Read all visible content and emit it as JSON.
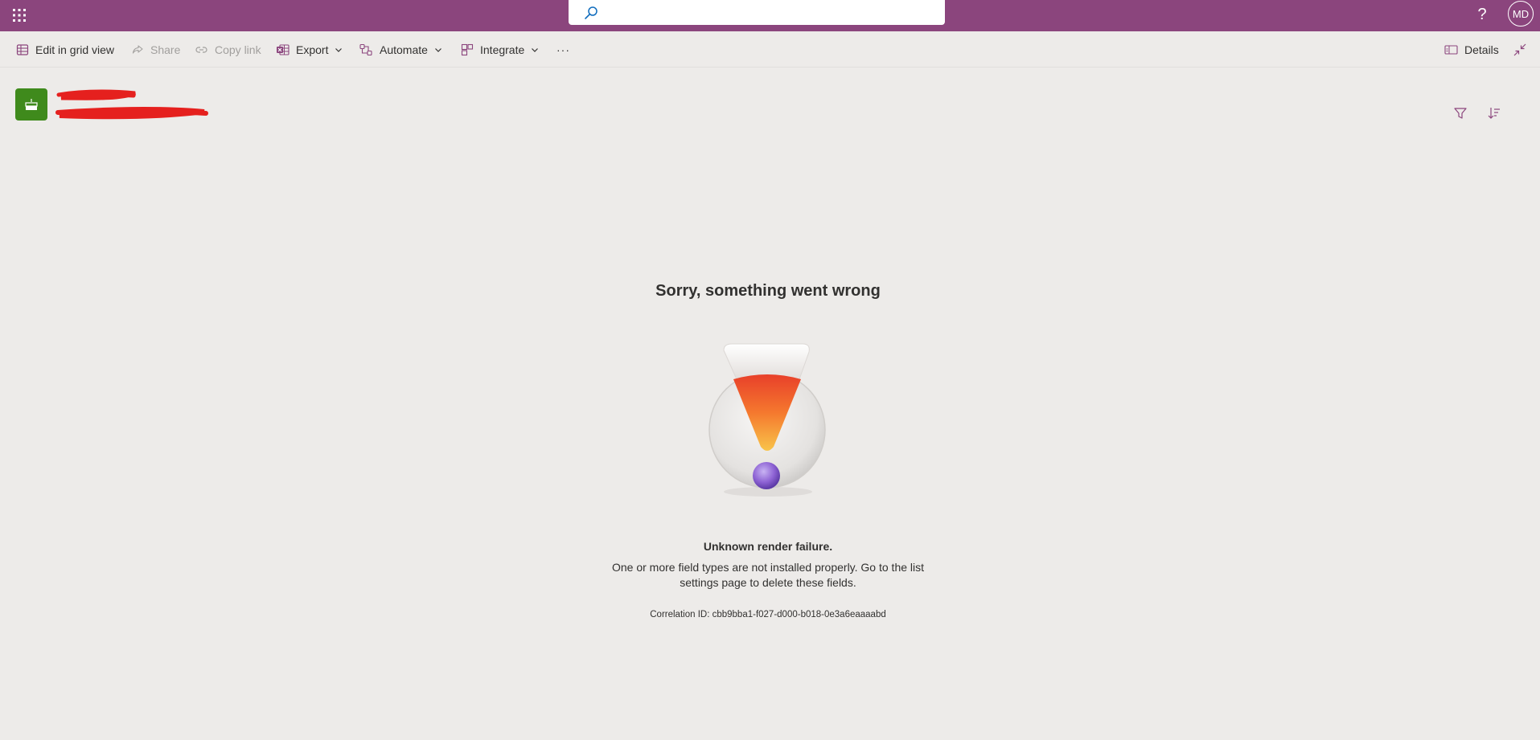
{
  "suite_bar": {
    "app_launcher_icon": "waffle-icon",
    "search": {
      "placeholder": "",
      "icon": "search-icon"
    },
    "help_label": "?",
    "user_initials": "MD",
    "brand_color": "#8b457d"
  },
  "command_bar": {
    "edit_grid_label": "Edit in grid view",
    "share_label": "Share",
    "copy_link_label": "Copy link",
    "export_label": "Export",
    "automate_label": "Automate",
    "integrate_label": "Integrate",
    "more_label": "···",
    "details_label": "Details"
  },
  "list_header": {
    "list_icon": "cake-icon",
    "icon_color": "#3f8a1c"
  },
  "error": {
    "title": "Sorry, something went wrong",
    "heading": "Unknown render failure.",
    "message": "One or more field types are not installed properly. Go to the list settings page to delete these fields.",
    "correlation_label": "Correlation ID:",
    "correlation_id": "cbb9bba1-f027-d000-b018-0e3a6eaaaabd"
  }
}
